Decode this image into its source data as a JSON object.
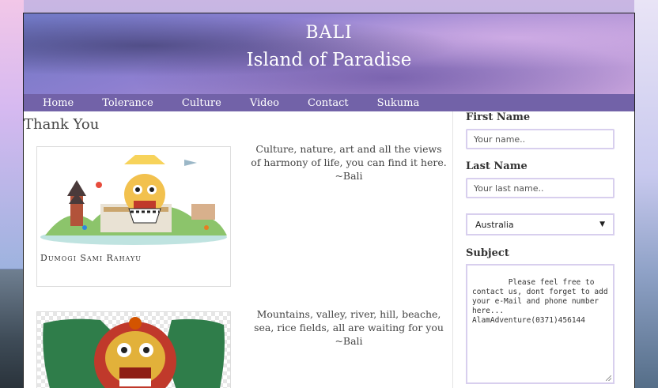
{
  "banner": {
    "title": "BALI",
    "subtitle": "Island of Paradise"
  },
  "nav": {
    "items": [
      "Home",
      "Tolerance",
      "Culture",
      "Video",
      "Contact",
      "Sukuma"
    ]
  },
  "main": {
    "heading": "Thank You",
    "cards": [
      {
        "caption": "Dumogi Sami Rahayu"
      },
      {
        "caption": ""
      }
    ],
    "quotes": [
      {
        "text": "Culture, nature, art and all the views of harmony of life, you can find it here.",
        "author": "~Bali"
      },
      {
        "text": "Mountains, valley, river, hill, beache, sea, rice fields, all are waiting for you",
        "author": "~Bali"
      }
    ]
  },
  "form": {
    "first_name_label": "First Name",
    "first_name_placeholder": "Your name..",
    "last_name_label": "Last Name",
    "last_name_placeholder": "Your last name..",
    "country_value": "Australia",
    "subject_label": "Subject",
    "subject_value": "Please feel free to contact us, dont forget to add your e-Mail and phone number here...\nAlamAdventure(0371)456144"
  },
  "colors": {
    "nav_bg": "#7262a8",
    "field_border": "#d8cfee"
  }
}
